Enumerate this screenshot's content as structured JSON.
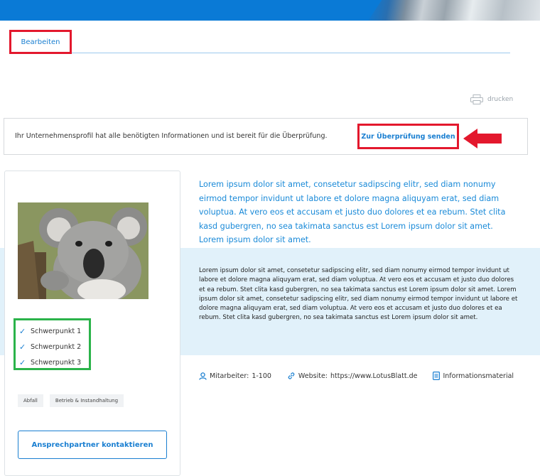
{
  "tabs": {
    "edit_label": "Bearbeiten"
  },
  "toolbar": {
    "print_label": "drucken"
  },
  "review": {
    "message": "Ihr Unternehmensprofil hat alle benötigten Informationen und ist bereit für die Überprüfung.",
    "button_label": "Zur Überprüfung senden"
  },
  "profile_card": {
    "focus_points": [
      "Schwerpunkt 1",
      "Schwerpunkt 2",
      "Schwerpunkt 3"
    ],
    "tags": [
      "Abfall",
      "Betrieb & Instandhaltung"
    ],
    "contact_button": "Ansprechpartner kontaktieren"
  },
  "content": {
    "intro": "Lorem ipsum dolor sit amet, consetetur sadipscing elitr, sed diam nonumy eirmod tempor invidunt ut labore et dolore magna aliquyam erat, sed diam voluptua. At vero eos et accusam et justo duo dolores et ea rebum. Stet clita kasd gubergren, no sea takimata sanctus est Lorem ipsum dolor sit amet. Lorem ipsum dolor sit amet.",
    "body": "Lorem ipsum dolor sit amet, consetetur sadipscing elitr, sed diam nonumy eirmod tempor invidunt ut labore et dolore magna aliquyam erat, sed diam voluptua. At vero eos et accusam et justo duo dolores et ea rebum. Stet clita kasd gubergren, no sea takimata sanctus est Lorem ipsum dolor sit amet. Lorem ipsum dolor sit amet, consetetur sadipscing elitr, sed diam nonumy eirmod tempor invidunt ut labore et dolore magna aliquyam erat, sed diam voluptua. At vero eos et accusam et justo duo dolores et ea rebum. Stet clita kasd gubergren, no sea takimata sanctus est Lorem ipsum dolor sit amet."
  },
  "facts": {
    "employees_label": "Mitarbeiter:",
    "employees_value": "1-100",
    "website_label": "Website:",
    "website_value": "https://www.LotusBlatt.de",
    "material_label": "Informationsmaterial"
  },
  "colors": {
    "accent": "#1a7fd1",
    "highlight": "#e3182d",
    "check_box": "#2bb34a",
    "band": "#e1f1fa"
  },
  "icons": [
    "printer-icon",
    "arrow-left-icon",
    "check-icon",
    "user-icon",
    "link-icon",
    "document-icon"
  ]
}
